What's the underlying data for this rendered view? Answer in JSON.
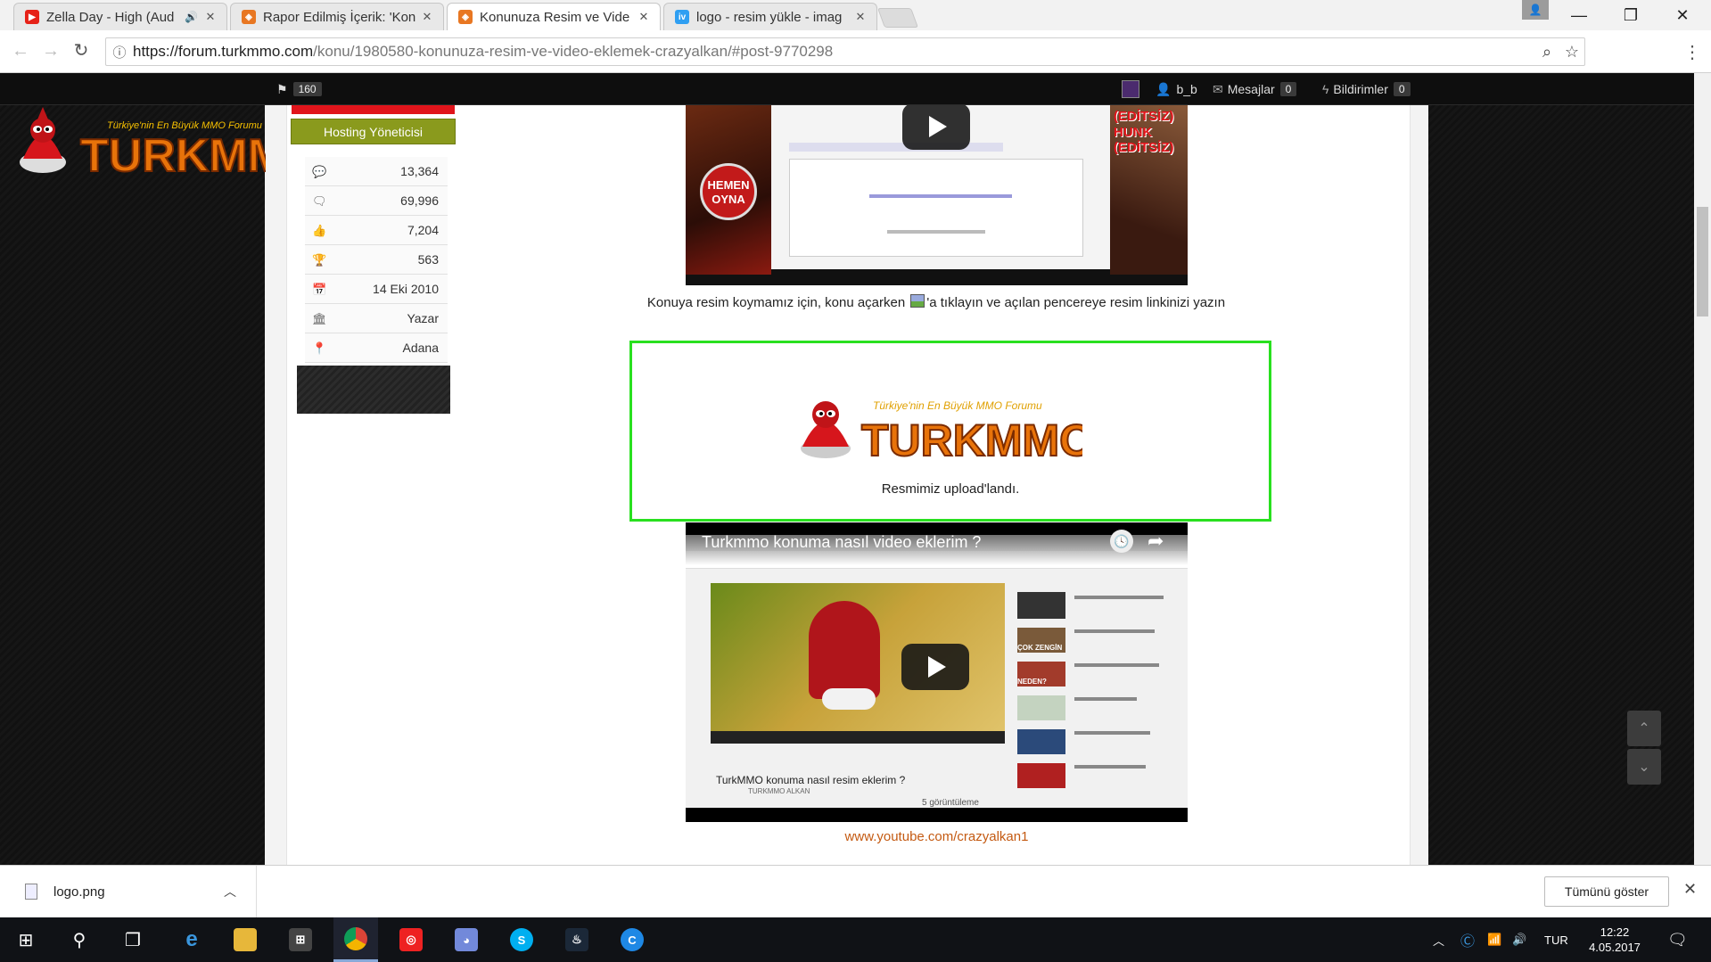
{
  "browser": {
    "tabs": [
      {
        "title": "Zella Day - High (Aud",
        "icon": "youtube-icon",
        "color": "#e62117",
        "audio": true
      },
      {
        "title": "Rapor Edilmiş İçerik: 'Kon",
        "icon": "turkmmo-icon",
        "color": "#e87722"
      },
      {
        "title": "Konunuza Resim ve Vide",
        "icon": "turkmmo-icon",
        "color": "#e87722",
        "active": true
      },
      {
        "title": "logo - resim yükle - imag",
        "icon": "imageshack-icon",
        "color": "#2f9ff2"
      }
    ],
    "url_host": "https://forum.turkmmo.com",
    "url_path": "/konu/1980580-konunuza-resim-ve-video-eklemek-crazyalkan/#post-9770298"
  },
  "site": {
    "flag_count": "160",
    "username": "b_b",
    "messages_label": "Mesajlar",
    "messages_count": "0",
    "notifications_label": "Bildirimler",
    "notifications_count": "0",
    "logo_tagline": "Türkiye'nin En Büyük MMO Forumu",
    "logo_word": "TURKMMO"
  },
  "sidebar": {
    "role": "Hosting Yöneticisi",
    "stats": [
      {
        "icon": "comment-icon",
        "value": "13,364"
      },
      {
        "icon": "comments-icon",
        "value": "69,996"
      },
      {
        "icon": "thumbs-up-icon",
        "value": "7,204"
      },
      {
        "icon": "trophy-icon",
        "value": "563"
      },
      {
        "icon": "calendar-icon",
        "value": "14 Eki 2010"
      },
      {
        "icon": "bank-icon",
        "value": "Yazar"
      },
      {
        "icon": "map-marker-icon",
        "value": "Adana"
      }
    ]
  },
  "post": {
    "video1": {
      "badge_1": "(EDİTSİZ)",
      "badge_2": "HUNK (EDİTSİZ)",
      "hemen": "HEMEN",
      "oyna": "OYNA"
    },
    "caption_before": "Konuya resim koymamız için, konu açarken",
    "caption_after": "'a tıklayın ve açılan pencereye resim linkinizi yazın",
    "image_caption": "Resmimiz upload'landı.",
    "video2": {
      "title": "Turkmmo konuma nasıl video eklerim ?",
      "inner_title": "TurkMMO konuma nasıl resim eklerim ?",
      "channel": "TURKMMO ALKAN",
      "views": "5 görüntüleme",
      "side_labels": [
        "ÇOK ZENGİN",
        "NEDEN?"
      ]
    },
    "link": "www.youtube.com/crazyalkan1"
  },
  "downloads": {
    "file": "logo.png",
    "show_all": "Tümünü göster"
  },
  "taskbar": {
    "lang": "TUR",
    "time": "12:22",
    "date": "4.05.2017"
  }
}
